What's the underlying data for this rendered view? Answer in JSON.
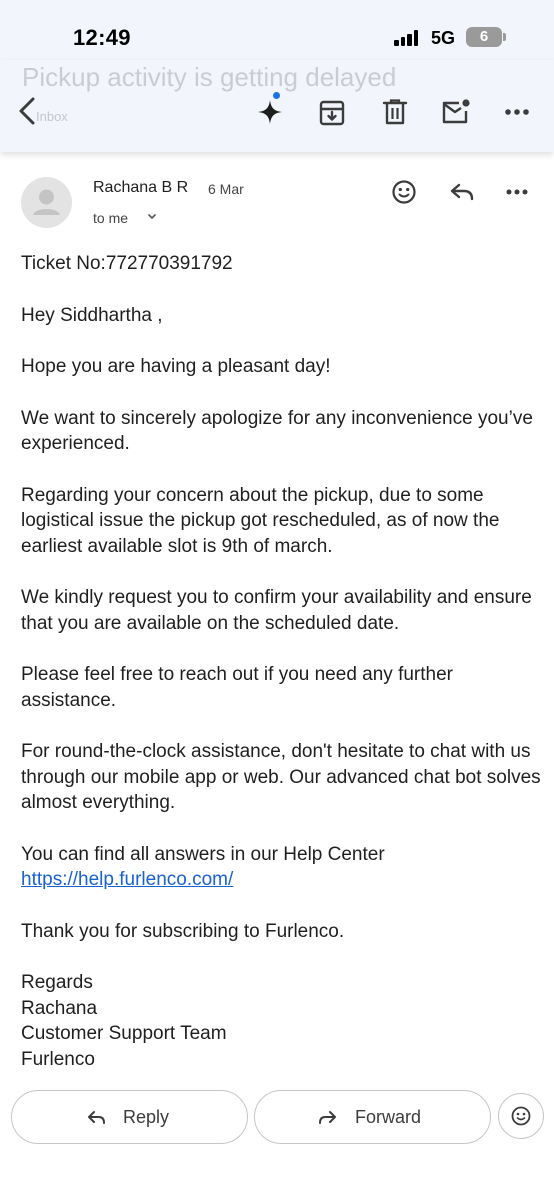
{
  "status_bar": {
    "time": "12:49",
    "network": "5G",
    "battery": "6"
  },
  "toolbar": {
    "subject_behind": "Pickup activity is getting delayed",
    "folder_behind": "Inbox",
    "icons": [
      "back-arrow-icon",
      "gemini-sparkle-icon",
      "archive-icon",
      "delete-icon",
      "mark-unread-icon",
      "more-options-icon"
    ]
  },
  "message": {
    "sender": "Rachana B R",
    "date": "6 Mar",
    "recipient": "to me",
    "paragraphs": [
      "Ticket No:772770391792",
      "Hey Siddhartha  ,",
      "Hope you are having a pleasant day!",
      "We want to sincerely apologize for any inconvenience you’ve experienced.",
      "Regarding your concern about the pickup, due to some logistical issue the pickup got rescheduled, as of now the earliest available slot is 9th of march.",
      "We kindly request you to confirm your availability and ensure that you are available on the scheduled date.",
      "Please feel free to reach out if you need any further assistance.",
      "For round-the-clock assistance, don't hesitate to chat with us through our mobile app or web. Our advanced chat bot solves almost everything."
    ],
    "help_text": "You can find all answers in our Help Center",
    "help_link": "https://help.furlenco.com/",
    "thanks": "Thank you for subscribing to Furlenco.",
    "signature": [
      "Regards",
      "Rachana",
      "Customer Support Team",
      "Furlenco"
    ]
  },
  "actions": {
    "reply": "Reply",
    "forward": "Forward"
  },
  "colors": {
    "toolbar_bg": "#f2f6fc",
    "link": "#1a62d2",
    "gemini_dot": "#1a73e8"
  }
}
